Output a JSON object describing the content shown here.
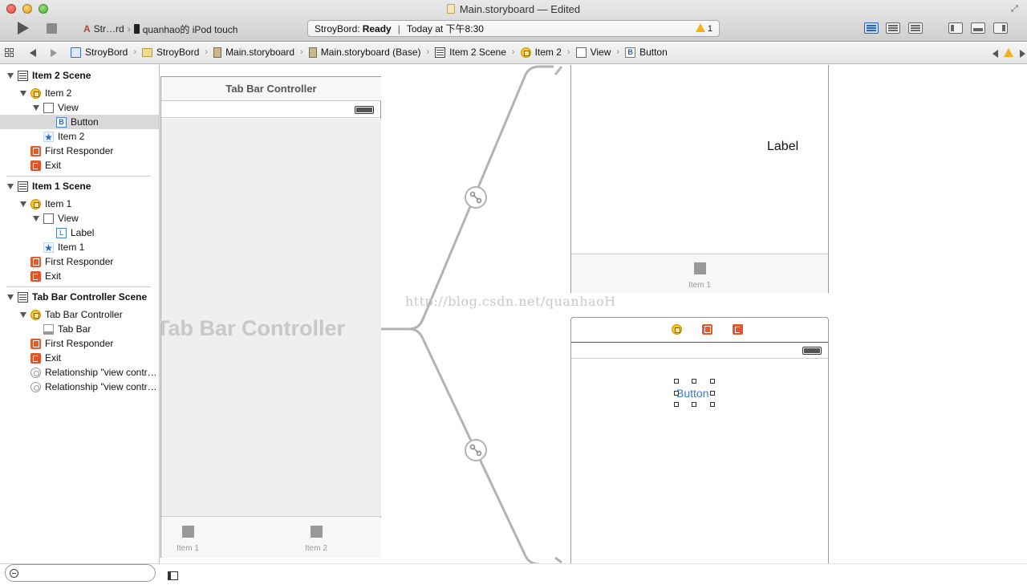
{
  "window": {
    "title": "Main.storyboard — Edited"
  },
  "toolbar": {
    "scheme_name": "Str…rd",
    "scheme_separator": "›",
    "device_name": "quanhao的 iPod touch",
    "activity_project": "StroyBord:",
    "activity_status": "Ready",
    "activity_divider": "|",
    "activity_time": "Today at 下午8:30",
    "activity_warning_count": "1"
  },
  "jumpbar": {
    "crumbs": [
      {
        "label": "StroyBord",
        "icon": "project-icon"
      },
      {
        "label": "StroyBord",
        "icon": "folder-icon"
      },
      {
        "label": "Main.storyboard",
        "icon": "storyboard-icon"
      },
      {
        "label": "Main.storyboard (Base)",
        "icon": "storyboard-icon"
      },
      {
        "label": "Item 2 Scene",
        "icon": "scene-icon"
      },
      {
        "label": "Item 2",
        "icon": "view-controller-icon"
      },
      {
        "label": "View",
        "icon": "view-icon"
      },
      {
        "label": "Button",
        "icon": "button-icon"
      }
    ],
    "chevron": "›"
  },
  "outline": {
    "item2_scene": "Item 2 Scene",
    "item2_vc": "Item 2",
    "item2_view": "View",
    "item2_button": "Button",
    "item2_tabitem": "Item 2",
    "item2_first_responder": "First Responder",
    "item2_exit": "Exit",
    "item1_scene": "Item 1 Scene",
    "item1_vc": "Item 1",
    "item1_view": "View",
    "item1_label": "Label",
    "item1_tabitem": "Item 1",
    "item1_first_responder": "First Responder",
    "item1_exit": "Exit",
    "tbc_scene": "Tab Bar Controller Scene",
    "tbc": "Tab Bar Controller",
    "tbc_tabbar": "Tab Bar",
    "tbc_first_responder": "First Responder",
    "tbc_exit": "Exit",
    "tbc_relationship_1": "Relationship \"view contr…",
    "tbc_relationship_2": "Relationship \"view contr…",
    "icon_letters": {
      "button": "B",
      "label": "L",
      "star": "★"
    }
  },
  "canvas": {
    "tbc_title": "Tab Bar Controller",
    "tbc_watermark": "Tab Bar Controller",
    "tbc_tab1": "Item 1",
    "tbc_tab2": "Item 2",
    "item1_label": "Label",
    "item1_tab": "Item 1",
    "item2_button": "Button",
    "watermark_url": "http://blog.csdn.net/quanhaoH"
  },
  "colors": {
    "accent_blue": "#2a5fc7",
    "button_text": "#3b78d8",
    "warning_yellow": "#f0b21b",
    "segue_gray": "#b3b3b3",
    "exit_orange": "#e5532a"
  }
}
